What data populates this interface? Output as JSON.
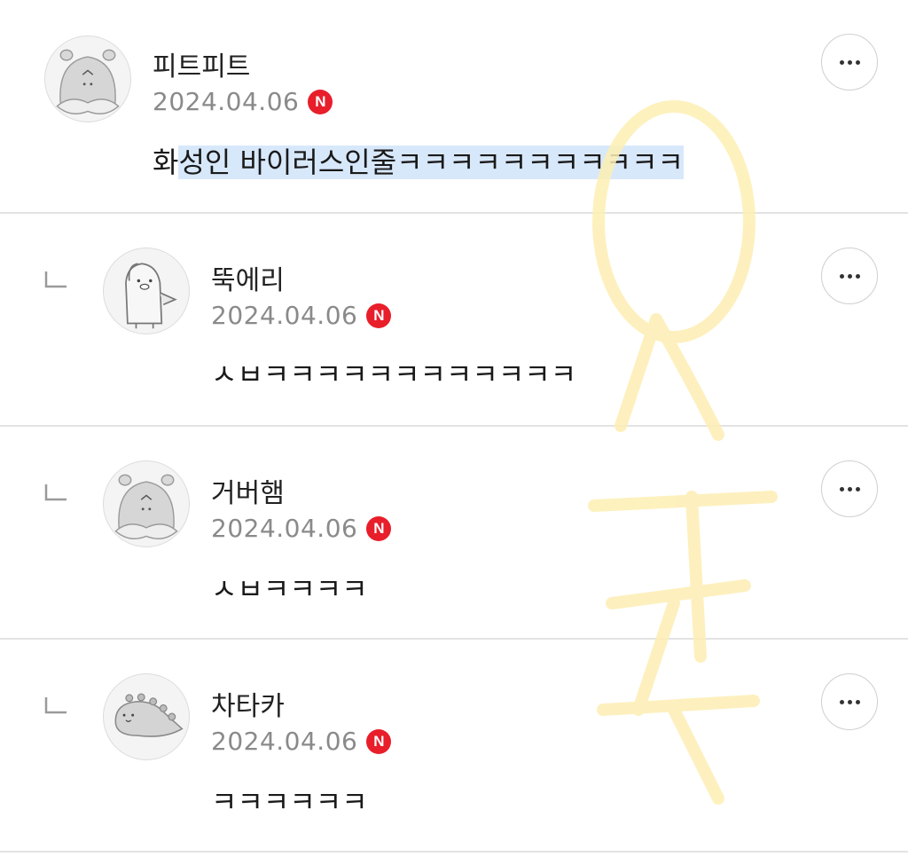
{
  "comments": [
    {
      "author": "피트피트",
      "date": "2024.04.06",
      "badge": "N",
      "text_plain": "화",
      "text_highlighted": "성인 바이러스인줄ㅋㅋㅋㅋㅋㅋㅋㅋㅋㅋㅋ",
      "avatar_icon": "hamster-avatar-icon",
      "is_reply": false
    },
    {
      "author": "뚝에리",
      "date": "2024.04.06",
      "badge": "N",
      "text": "ㅅㅂㅋㅋㅋㅋㅋㅋㅋㅋㅋㅋㅋㅋ",
      "avatar_icon": "penguin-avatar-icon",
      "is_reply": true
    },
    {
      "author": "거버햄",
      "date": "2024.04.06",
      "badge": "N",
      "text": "ㅅㅂㅋㅋㅋㅋ",
      "avatar_icon": "hamster-avatar-icon",
      "is_reply": true
    },
    {
      "author": "차타카",
      "date": "2024.04.06",
      "badge": "N",
      "text": "ㅋㅋㅋㅋㅋㅋ",
      "avatar_icon": "dinosaur-avatar-icon",
      "is_reply": true
    }
  ],
  "colors": {
    "badge": "#e81e2a",
    "highlight": "#d8e8fb",
    "watermark": "#fdeeb3"
  }
}
